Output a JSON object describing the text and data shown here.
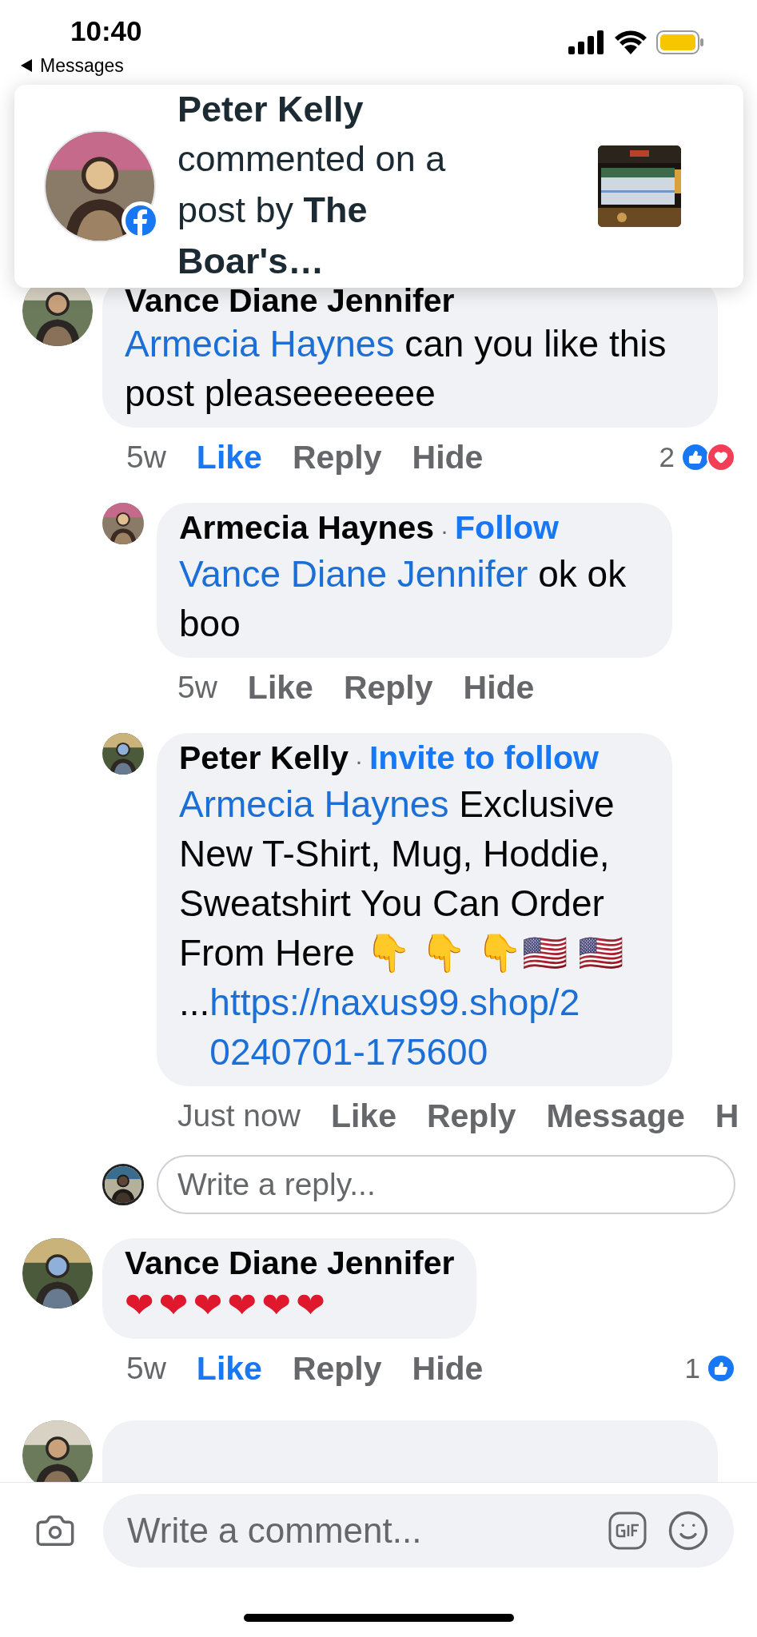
{
  "status_bar": {
    "time": "10:40",
    "back_label": "Messages"
  },
  "notification": {
    "name": "Peter Kelly",
    "text": "commented on a post by **The Boar's…**"
  },
  "comments": [
    {
      "kind": "comment",
      "author": "Vance Diane Jennifer",
      "mention": "Armecia Haynes",
      "text": "can you like this post pleaseeeeeee",
      "liked": true,
      "actions": [
        {
          "kind": "time",
          "label": "5w"
        },
        {
          "kind": "like",
          "label": "Like"
        },
        {
          "kind": "action",
          "label": "Reply"
        },
        {
          "kind": "action",
          "label": "Hide"
        }
      ],
      "reactions": {
        "count": "2",
        "like": true,
        "love": true
      },
      "replies": [
        {
          "author": "Armecia Haynes",
          "separator": "·",
          "follow": "Follow",
          "mention": "Vance Diane Jennifer",
          "text": "ok ok boo",
          "liked": false,
          "actions": [
            {
              "kind": "time",
              "label": "5w"
            },
            {
              "kind": "like",
              "label": "Like"
            },
            {
              "kind": "action",
              "label": "Reply"
            },
            {
              "kind": "action",
              "label": "Hide"
            }
          ]
        },
        {
          "author": "Peter Kelly",
          "separator": "·",
          "follow": "Invite to follow",
          "mention": "Armecia Haynes",
          "text": "Exclusive New T-Shirt, Mug, Hoddie, Sweatshirt You Can Order From Here 👇 👇  👇🇺🇸 🇺🇸",
          "link_prefix": "...",
          "link": "https://naxus99.shop/20240701-175600",
          "liked": false,
          "actions": [
            {
              "kind": "time",
              "label": "Just now"
            },
            {
              "kind": "like",
              "label": "Like"
            },
            {
              "kind": "action",
              "label": "Reply"
            },
            {
              "kind": "action",
              "label": "Message"
            },
            {
              "kind": "action",
              "label": "H"
            }
          ]
        }
      ],
      "reply_box": {
        "placeholder": "Write a reply..."
      }
    },
    {
      "kind": "comment",
      "author": "Vance Diane Jennifer",
      "hearts": "❤❤❤❤❤❤",
      "liked": true,
      "actions": [
        {
          "kind": "time",
          "label": "5w"
        },
        {
          "kind": "like",
          "label": "Like"
        },
        {
          "kind": "action",
          "label": "Reply"
        },
        {
          "kind": "action",
          "label": "Hide"
        }
      ],
      "reactions": {
        "count": "1",
        "like": true
      }
    },
    {
      "kind": "partial"
    }
  ],
  "composer": {
    "placeholder": "Write a comment..."
  }
}
